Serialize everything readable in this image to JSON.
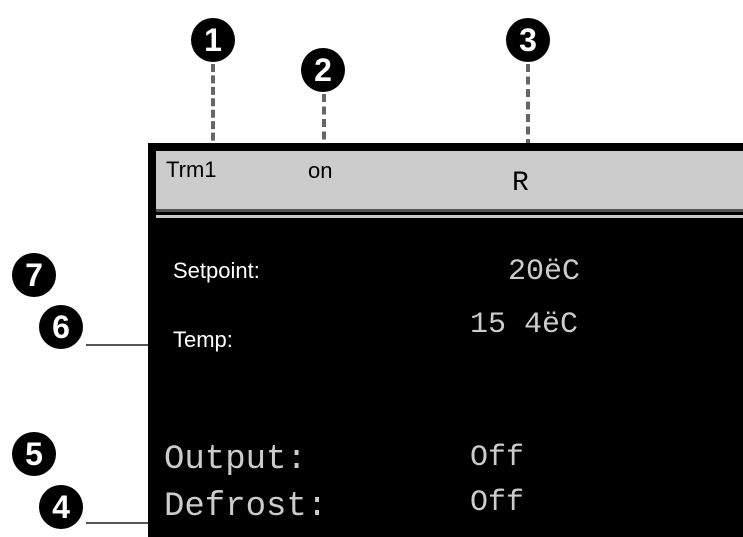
{
  "callouts": [
    "1",
    "2",
    "3",
    "4",
    "5",
    "6",
    "7"
  ],
  "header": {
    "terminal": "Trm1",
    "status": "on",
    "mode": "R"
  },
  "readings": {
    "setpoint_label": "Setpoint:",
    "setpoint_value": "20ëC",
    "temp_label": "Temp:",
    "temp_value": "15 4ëC"
  },
  "states": {
    "output_label": "Output:",
    "output_value": "Off",
    "defrost_label": "Defrost:",
    "defrost_value": "Off"
  },
  "colors": {
    "screen_bg": "#000000",
    "header_bg": "#cccccc",
    "callout_bg": "#000000",
    "callout_fg": "#ffffff",
    "dash": "#666666"
  }
}
